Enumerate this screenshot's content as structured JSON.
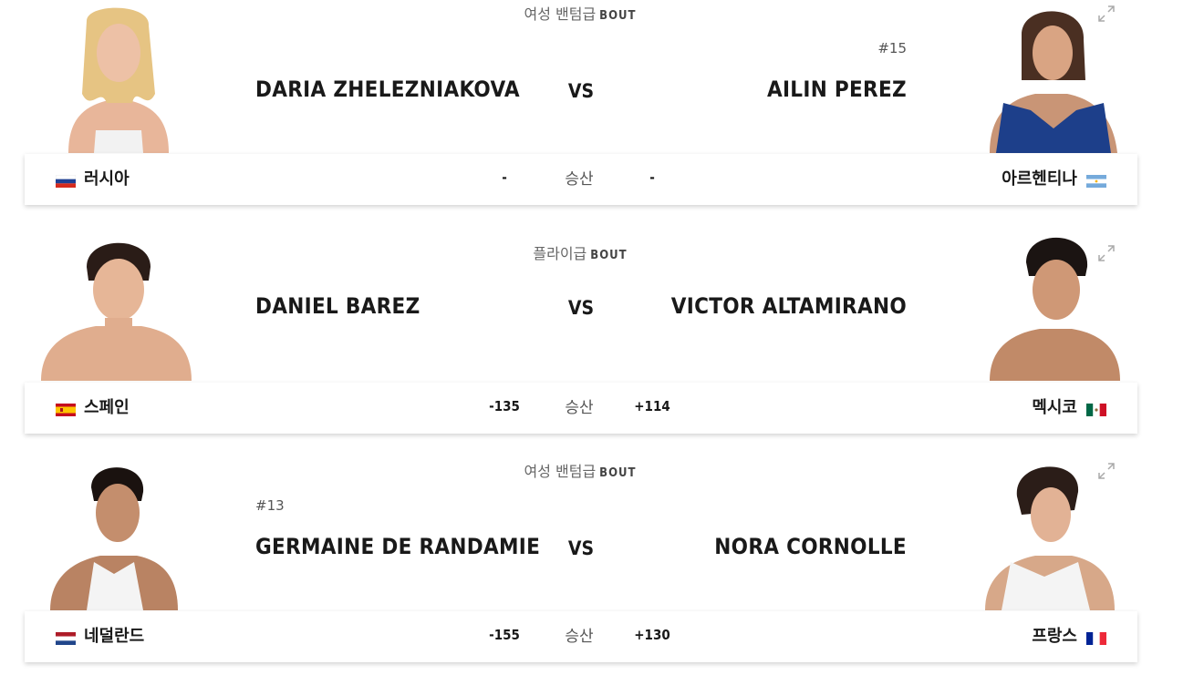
{
  "bouts": [
    {
      "division": "여성 밴텀급",
      "bout_word": "BOUT",
      "left": {
        "rank": "",
        "name": "DARIA ZHELEZNIAKOVA",
        "country": "러시아",
        "odds": "-",
        "flag": "russia"
      },
      "right": {
        "rank": "#15",
        "name": "AILIN PEREZ",
        "country": "아르헨티나",
        "odds": "-",
        "flag": "argentina"
      },
      "vs": "VS",
      "result_label": "승산"
    },
    {
      "division": "플라이급",
      "bout_word": "BOUT",
      "left": {
        "rank": "",
        "name": "DANIEL BAREZ",
        "country": "스페인",
        "odds": "-135",
        "flag": "spain"
      },
      "right": {
        "rank": "",
        "name": "VICTOR ALTAMIRANO",
        "country": "멕시코",
        "odds": "+114",
        "flag": "mexico"
      },
      "vs": "VS",
      "result_label": "승산"
    },
    {
      "division": "여성 밴텀급",
      "bout_word": "BOUT",
      "left": {
        "rank": "#13",
        "name": "GERMAINE DE RANDAMIE",
        "country": "네덜란드",
        "odds": "-155",
        "flag": "netherlands"
      },
      "right": {
        "rank": "",
        "name": "NORA CORNOLLE",
        "country": "프랑스",
        "odds": "+130",
        "flag": "france"
      },
      "vs": "VS",
      "result_label": "승산"
    }
  ],
  "icons": {
    "expand": "expand-icon",
    "portrait": "fighter-photo"
  }
}
